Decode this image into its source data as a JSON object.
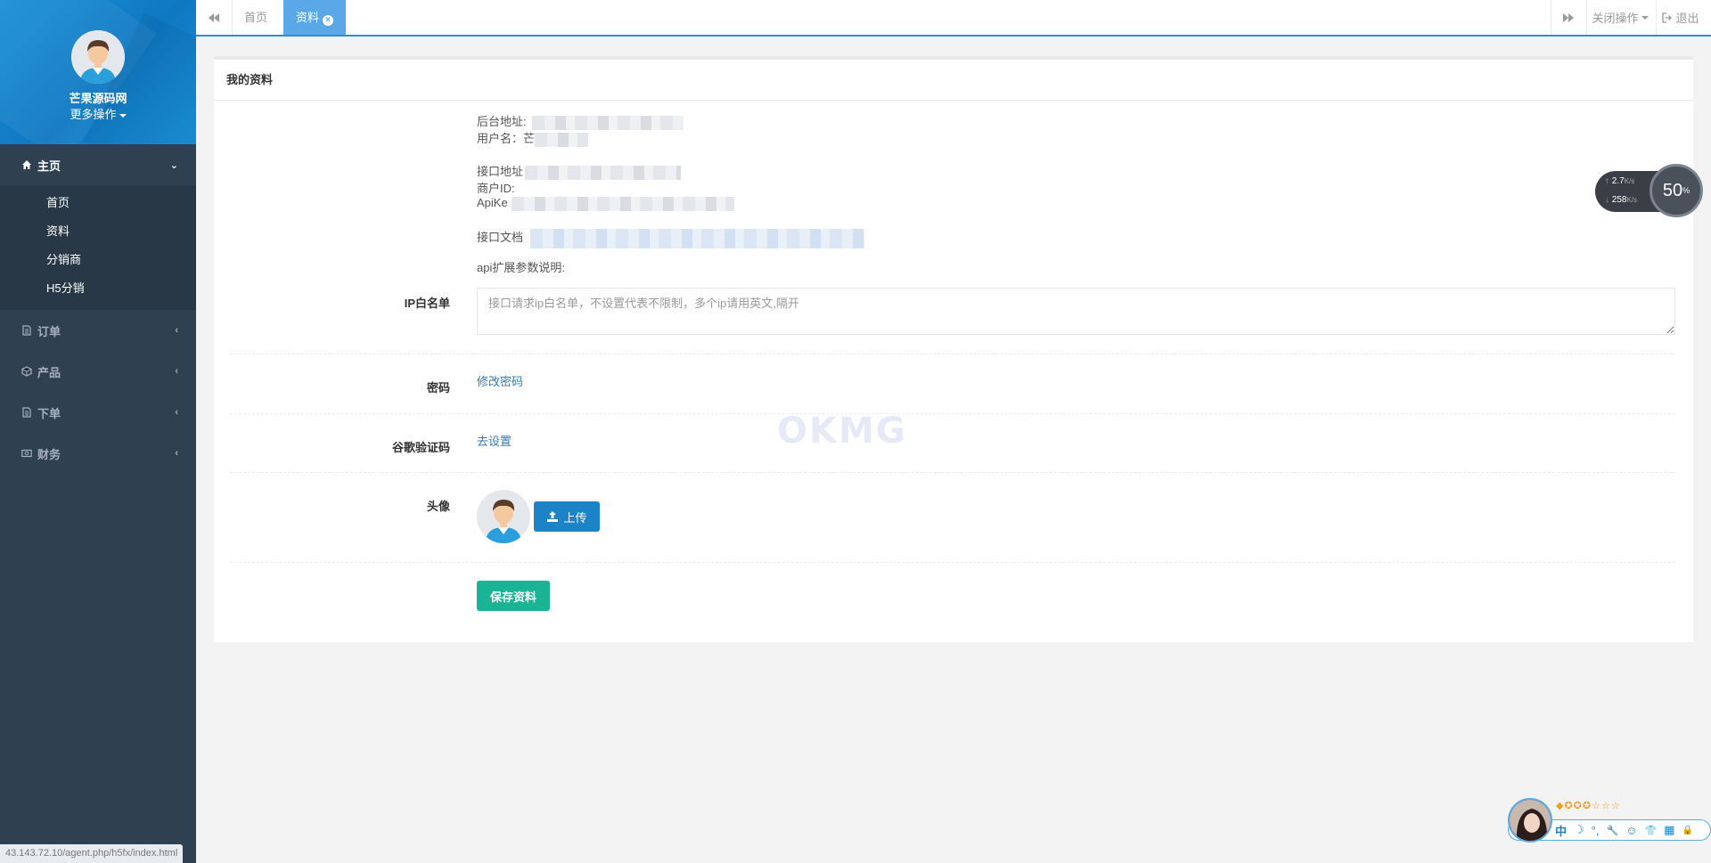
{
  "sidebar": {
    "site_name": "芒果源码网",
    "more_ops": "更多操作",
    "groups": [
      {
        "label": "主页",
        "icon": "home-icon",
        "expanded": true,
        "items": [
          "首页",
          "资料",
          "分销商",
          "H5分销"
        ]
      },
      {
        "label": "订单",
        "icon": "file-icon"
      },
      {
        "label": "产品",
        "icon": "cube-icon"
      },
      {
        "label": "下单",
        "icon": "file-icon"
      },
      {
        "label": "财务",
        "icon": "money-icon"
      }
    ]
  },
  "topbar": {
    "tabs": [
      {
        "label": "首页",
        "active": false
      },
      {
        "label": "资料",
        "active": true
      }
    ],
    "close_ops": "关闭操作",
    "logout": "退出"
  },
  "panel": {
    "title": "我的资料",
    "info": {
      "backend_addr": "后台地址:",
      "username": "用户名：芒",
      "api_addr": "接口地址",
      "merchant_id": "商户ID:",
      "apikey": "ApiKe",
      "api_doc": "接口文档",
      "api_ext": "api扩展参数说明:"
    },
    "ip_whitelist": {
      "label": "IP白名单",
      "placeholder": "接口请求ip白名单，不设置代表不限制，多个ip请用英文,隔开",
      "value": ""
    },
    "password": {
      "label": "密码",
      "link": "修改密码"
    },
    "google_auth": {
      "label": "谷歌验证码",
      "link": "去设置"
    },
    "avatar": {
      "label": "头像",
      "upload": "上传"
    },
    "save": "保存资料",
    "watermark": "OKMG"
  },
  "speed_widget": {
    "up": "2.7",
    "down": "258",
    "unit": "K/s",
    "percent": "50",
    "percent_sign": "%"
  },
  "ime": {
    "items": [
      "中",
      "☽",
      "°,",
      "🔧",
      "☺",
      "👕",
      "▦",
      "🔒"
    ]
  },
  "status_url": "43.143.72.10/agent.php/h5fx/index.html"
}
